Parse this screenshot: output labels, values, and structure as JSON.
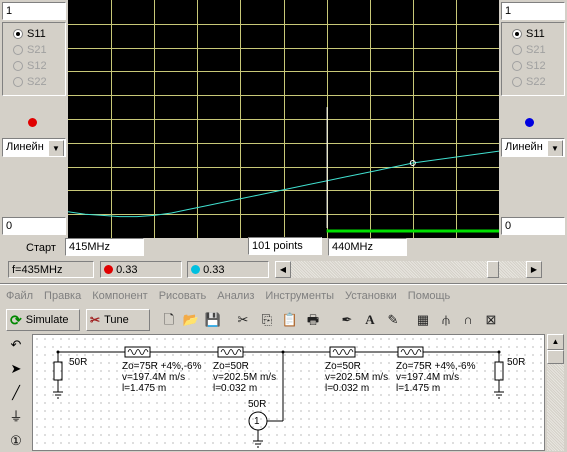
{
  "left_panel": {
    "index_value": "1",
    "params": [
      "S11",
      "S21",
      "S12",
      "S22"
    ],
    "selected": "S11",
    "marker_color": "#e00000",
    "scale_mode": "Линейн",
    "min_value": "0"
  },
  "right_panel": {
    "index_value": "1",
    "params": [
      "S11",
      "S21",
      "S12",
      "S22"
    ],
    "selected": "S11",
    "marker_color": "#0000e0",
    "scale_mode": "Линейн",
    "min_value": "0"
  },
  "sweep": {
    "start_label": "Старт",
    "start_value": "415MHz",
    "points_value": "101 points",
    "stop_value": "440MHz"
  },
  "status": {
    "frequency": "f=435MHz",
    "marker1_value": "0.33",
    "marker2_value": "0.33",
    "marker1_color": "#e00000",
    "marker2_color": "#00c0e0",
    "scroll_position": 0.88
  },
  "menu": [
    "Файл",
    "Правка",
    "Компонент",
    "Рисовать",
    "Анализ",
    "Инструменты",
    "Установки",
    "Помощь"
  ],
  "toolbar": {
    "simulate_label": "Simulate",
    "tune_label": "Tune",
    "icons": [
      "new-file-icon",
      "open-folder-icon",
      "save-icon",
      "cut-icon",
      "copy-icon",
      "paste-icon",
      "print-icon",
      "probe-icon",
      "text-icon",
      "pen-icon",
      "calculator-icon",
      "antenna-icon",
      "coil-icon",
      "formula-icon"
    ]
  },
  "chart_data": {
    "type": "line",
    "background": "#000000",
    "grid": true,
    "grid_color": "#c8c878",
    "trace_color": "#40e0d0",
    "x_range": [
      415,
      440
    ],
    "x_unit": "MHz",
    "x": [
      415,
      416,
      417,
      418,
      419,
      420,
      421,
      422,
      423,
      424,
      425,
      426,
      427,
      428,
      429,
      430,
      431,
      432,
      433,
      434,
      435,
      436,
      437,
      438,
      439,
      440
    ],
    "y": [
      0.11,
      0.1,
      0.095,
      0.09,
      0.09,
      0.095,
      0.105,
      0.12,
      0.135,
      0.15,
      0.165,
      0.18,
      0.195,
      0.21,
      0.225,
      0.24,
      0.255,
      0.27,
      0.285,
      0.3,
      0.315,
      0.325,
      0.335,
      0.345,
      0.355,
      0.365
    ],
    "ylim": [
      0,
      1
    ],
    "marker_x": 435,
    "band": {
      "x_start": 430,
      "x_end": 440,
      "color": "#00e000"
    }
  },
  "schematic": {
    "port1_resistor": "50R",
    "port2_resistor": "50R",
    "tl1": {
      "z": "Zo=75R  +4%,-6%",
      "v": "v=197.4M m/s",
      "l": "l=1.475 m"
    },
    "tl2": {
      "z": "Zo=50R",
      "v": "v=202.5M m/s",
      "l": "l=0.032 m"
    },
    "tl3": {
      "z": "Zo=50R",
      "v": "v=202.5M m/s",
      "l": "l=0.032 m"
    },
    "tl4": {
      "z": "Zo=75R  +4%,-6%",
      "v": "v=197.4M m/s",
      "l": "l=1.475 m"
    },
    "source_resistor": "50R",
    "source_number": "1"
  }
}
